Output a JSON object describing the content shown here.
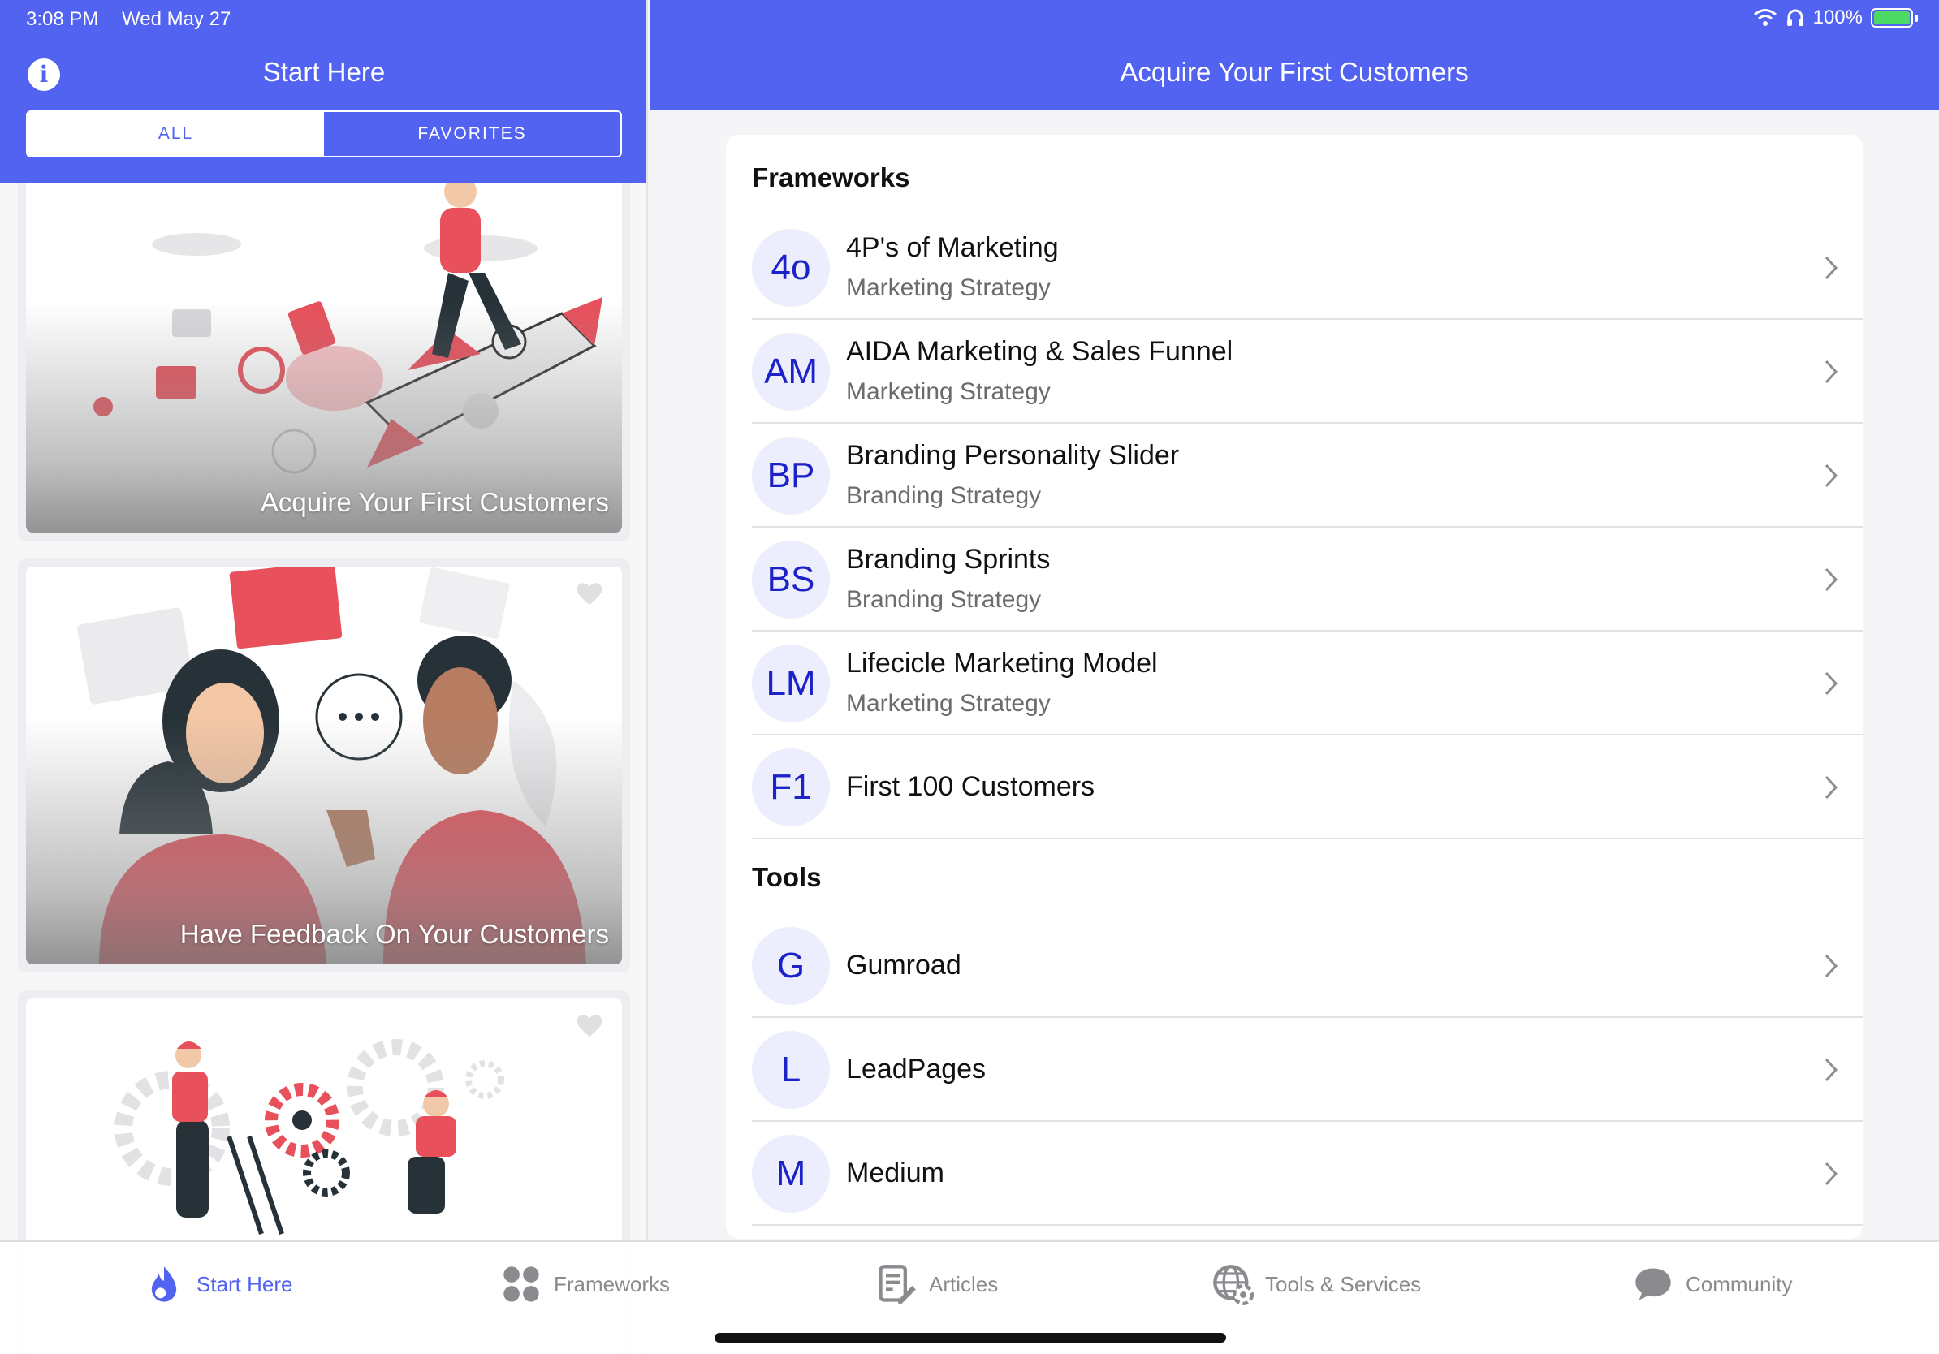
{
  "status_bar": {
    "time": "3:08 PM",
    "date": "Wed May 27",
    "battery": "100%"
  },
  "left": {
    "title": "Start Here",
    "segments": [
      "ALL",
      "FAVORITES"
    ],
    "cards": [
      {
        "title": "Acquire Your First Customers"
      },
      {
        "title": "Have Feedback On Your Customers"
      },
      {
        "title": ""
      }
    ]
  },
  "right": {
    "title": "Acquire Your First Customers",
    "sections": [
      {
        "title": "Frameworks",
        "items": [
          {
            "initials": "4o",
            "title": "4P's of Marketing",
            "subtitle": "Marketing Strategy"
          },
          {
            "initials": "AM",
            "title": "AIDA Marketing & Sales Funnel",
            "subtitle": "Marketing Strategy"
          },
          {
            "initials": "BP",
            "title": "Branding Personality Slider",
            "subtitle": "Branding Strategy"
          },
          {
            "initials": "BS",
            "title": "Branding Sprints",
            "subtitle": "Branding Strategy"
          },
          {
            "initials": "LM",
            "title": "Lifecicle Marketing Model",
            "subtitle": "Marketing Strategy"
          },
          {
            "initials": "F1",
            "title": "First 100 Customers",
            "subtitle": ""
          }
        ]
      },
      {
        "title": "Tools",
        "items": [
          {
            "initials": "G",
            "title": "Gumroad",
            "subtitle": ""
          },
          {
            "initials": "L",
            "title": "LeadPages",
            "subtitle": ""
          },
          {
            "initials": "M",
            "title": "Medium",
            "subtitle": ""
          }
        ]
      }
    ]
  },
  "tabs": [
    {
      "label": "Start Here",
      "icon": "flame-icon",
      "active": true
    },
    {
      "label": "Frameworks",
      "icon": "grid-icon",
      "active": false
    },
    {
      "label": "Articles",
      "icon": "document-edit-icon",
      "active": false
    },
    {
      "label": "Tools & Services",
      "icon": "globe-gear-icon",
      "active": false
    },
    {
      "label": "Community",
      "icon": "chat-bubble-icon",
      "active": false
    }
  ],
  "colors": {
    "accent": "#5163f0",
    "avatar_bg": "#eceefe",
    "avatar_text": "#1c22c8",
    "illustration_red": "#e8505b"
  }
}
